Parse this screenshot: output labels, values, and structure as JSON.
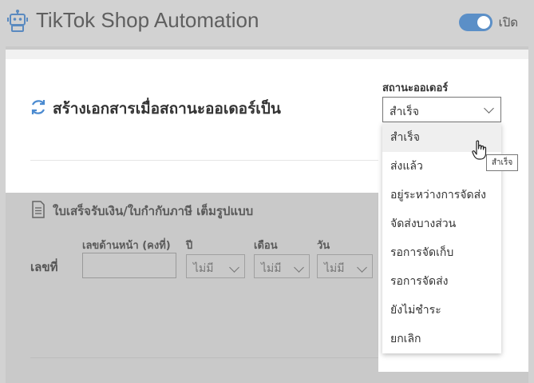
{
  "header": {
    "app_title": "TikTok Shop Automation",
    "toggle_label": "เปิด",
    "toggle_on": true
  },
  "order_doc": {
    "title": "สร้างเอกสารเมื่อสถานะออเดอร์เป็น",
    "status_label": "สถานะออเดอร์",
    "status_value": "สำเร็จ",
    "options": [
      "สำเร็จ",
      "ส่งแล้ว",
      "อยู่ระหว่างการจัดส่ง",
      "จัดส่งบางส่วน",
      "รอการจัดเก็บ",
      "รอการจัดส่ง",
      "ยังไม่ชำระ",
      "ยกเลิก"
    ],
    "hovered_option": "สำเร็จ",
    "tooltip": "สำเร็จ"
  },
  "receipt": {
    "title": "ใบเสร็จรับเงิน/ใบกำกับภาษี เต็มรูปแบบ",
    "row_label": "เลขที่",
    "prefix_label": "เลขด้านหน้า (คงที่)",
    "prefix_value": "",
    "year_label": "ปี",
    "year_value": "ไม่มี",
    "month_label": "เดือน",
    "month_value": "ไม่มี",
    "day_label": "วัน",
    "day_value": "ไม่มี"
  },
  "colors": {
    "toggle_accent": "#5b8fc7",
    "overlay": "#c9c9c9"
  }
}
